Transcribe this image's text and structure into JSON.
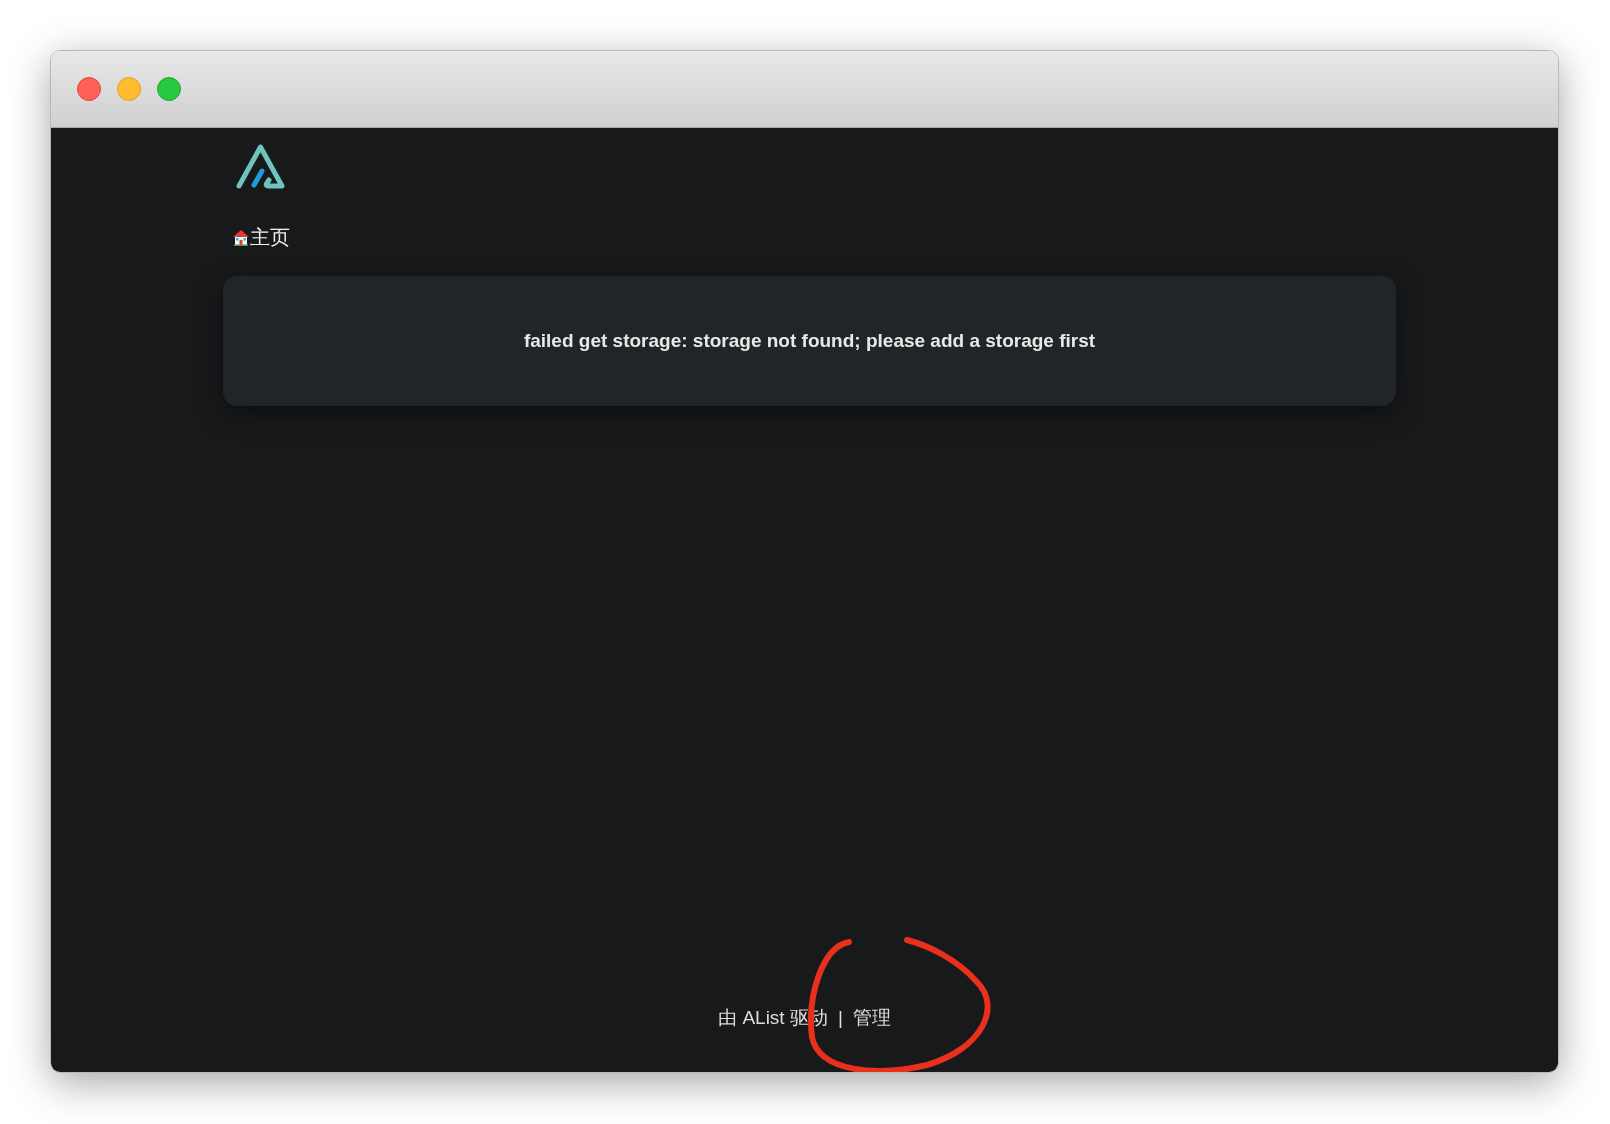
{
  "breadcrumb": {
    "label": "主页"
  },
  "message": "failed get storage: storage not found; please add a storage first",
  "footer": {
    "powered_by": "由 AList 驱动",
    "separator": "|",
    "admin_link": "管理"
  }
}
